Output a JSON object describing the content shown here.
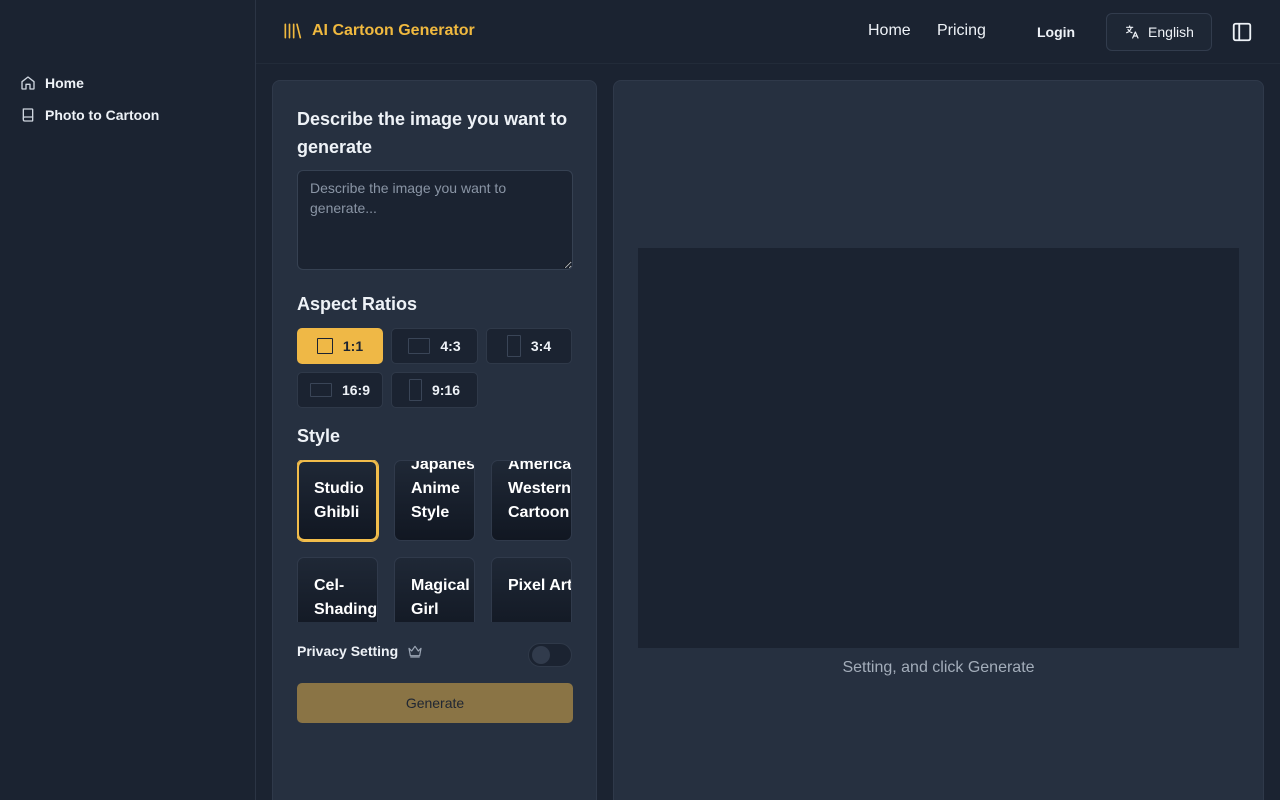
{
  "sidebar": {
    "items": [
      {
        "label": "Home",
        "icon": "home-icon"
      },
      {
        "label": "Photo to Cartoon",
        "icon": "book-icon"
      }
    ]
  },
  "header": {
    "brand": "AI Cartoon Generator",
    "brand_icon": "library-icon",
    "nav": [
      "Home",
      "Pricing"
    ],
    "login": "Login",
    "language": "English",
    "language_icon": "translate-icon",
    "panel_icon": "sidebar-toggle-icon"
  },
  "form": {
    "title": "Describe the image you want to generate",
    "prompt_placeholder": "Describe the image you want to generate...",
    "prompt_value": "",
    "aspect_label": "Aspect Ratios",
    "aspect_ratios": [
      {
        "label": "1:1",
        "selected": true
      },
      {
        "label": "4:3",
        "selected": false
      },
      {
        "label": "3:4",
        "selected": false
      },
      {
        "label": "16:9",
        "selected": false
      },
      {
        "label": "9:16",
        "selected": false
      }
    ],
    "style_label": "Style",
    "styles": [
      {
        "label": "Studio Ghibli",
        "selected": true
      },
      {
        "label": "Japanese Anime Style",
        "selected": false
      },
      {
        "label": "American Western Cartoon",
        "selected": false
      },
      {
        "label": "Cel-Shading",
        "selected": false
      },
      {
        "label": "Magical Girl",
        "selected": false
      },
      {
        "label": "Pixel Art",
        "selected": false
      }
    ],
    "privacy_label": "Privacy Setting",
    "privacy_icon": "crown-icon",
    "privacy_enabled": false,
    "generate_label": "Generate"
  },
  "preview": {
    "hint": "Setting, and click Generate"
  },
  "colors": {
    "accent": "#efb846",
    "background": "#1b2331",
    "panel": "#263040",
    "generate_disabled": "#8a7445"
  }
}
